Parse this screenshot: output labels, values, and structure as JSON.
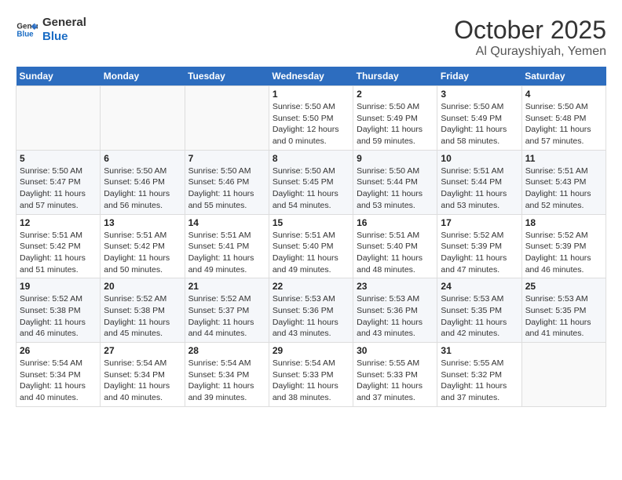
{
  "header": {
    "logo_line1": "General",
    "logo_line2": "Blue",
    "title": "October 2025",
    "location": "Al Qurayshiyah, Yemen"
  },
  "days_of_week": [
    "Sunday",
    "Monday",
    "Tuesday",
    "Wednesday",
    "Thursday",
    "Friday",
    "Saturday"
  ],
  "weeks": [
    [
      {
        "day": "",
        "info": ""
      },
      {
        "day": "",
        "info": ""
      },
      {
        "day": "",
        "info": ""
      },
      {
        "day": "1",
        "info": "Sunrise: 5:50 AM\nSunset: 5:50 PM\nDaylight: 12 hours\nand 0 minutes."
      },
      {
        "day": "2",
        "info": "Sunrise: 5:50 AM\nSunset: 5:49 PM\nDaylight: 11 hours\nand 59 minutes."
      },
      {
        "day": "3",
        "info": "Sunrise: 5:50 AM\nSunset: 5:49 PM\nDaylight: 11 hours\nand 58 minutes."
      },
      {
        "day": "4",
        "info": "Sunrise: 5:50 AM\nSunset: 5:48 PM\nDaylight: 11 hours\nand 57 minutes."
      }
    ],
    [
      {
        "day": "5",
        "info": "Sunrise: 5:50 AM\nSunset: 5:47 PM\nDaylight: 11 hours\nand 57 minutes."
      },
      {
        "day": "6",
        "info": "Sunrise: 5:50 AM\nSunset: 5:46 PM\nDaylight: 11 hours\nand 56 minutes."
      },
      {
        "day": "7",
        "info": "Sunrise: 5:50 AM\nSunset: 5:46 PM\nDaylight: 11 hours\nand 55 minutes."
      },
      {
        "day": "8",
        "info": "Sunrise: 5:50 AM\nSunset: 5:45 PM\nDaylight: 11 hours\nand 54 minutes."
      },
      {
        "day": "9",
        "info": "Sunrise: 5:50 AM\nSunset: 5:44 PM\nDaylight: 11 hours\nand 53 minutes."
      },
      {
        "day": "10",
        "info": "Sunrise: 5:51 AM\nSunset: 5:44 PM\nDaylight: 11 hours\nand 53 minutes."
      },
      {
        "day": "11",
        "info": "Sunrise: 5:51 AM\nSunset: 5:43 PM\nDaylight: 11 hours\nand 52 minutes."
      }
    ],
    [
      {
        "day": "12",
        "info": "Sunrise: 5:51 AM\nSunset: 5:42 PM\nDaylight: 11 hours\nand 51 minutes."
      },
      {
        "day": "13",
        "info": "Sunrise: 5:51 AM\nSunset: 5:42 PM\nDaylight: 11 hours\nand 50 minutes."
      },
      {
        "day": "14",
        "info": "Sunrise: 5:51 AM\nSunset: 5:41 PM\nDaylight: 11 hours\nand 49 minutes."
      },
      {
        "day": "15",
        "info": "Sunrise: 5:51 AM\nSunset: 5:40 PM\nDaylight: 11 hours\nand 49 minutes."
      },
      {
        "day": "16",
        "info": "Sunrise: 5:51 AM\nSunset: 5:40 PM\nDaylight: 11 hours\nand 48 minutes."
      },
      {
        "day": "17",
        "info": "Sunrise: 5:52 AM\nSunset: 5:39 PM\nDaylight: 11 hours\nand 47 minutes."
      },
      {
        "day": "18",
        "info": "Sunrise: 5:52 AM\nSunset: 5:39 PM\nDaylight: 11 hours\nand 46 minutes."
      }
    ],
    [
      {
        "day": "19",
        "info": "Sunrise: 5:52 AM\nSunset: 5:38 PM\nDaylight: 11 hours\nand 46 minutes."
      },
      {
        "day": "20",
        "info": "Sunrise: 5:52 AM\nSunset: 5:38 PM\nDaylight: 11 hours\nand 45 minutes."
      },
      {
        "day": "21",
        "info": "Sunrise: 5:52 AM\nSunset: 5:37 PM\nDaylight: 11 hours\nand 44 minutes."
      },
      {
        "day": "22",
        "info": "Sunrise: 5:53 AM\nSunset: 5:36 PM\nDaylight: 11 hours\nand 43 minutes."
      },
      {
        "day": "23",
        "info": "Sunrise: 5:53 AM\nSunset: 5:36 PM\nDaylight: 11 hours\nand 43 minutes."
      },
      {
        "day": "24",
        "info": "Sunrise: 5:53 AM\nSunset: 5:35 PM\nDaylight: 11 hours\nand 42 minutes."
      },
      {
        "day": "25",
        "info": "Sunrise: 5:53 AM\nSunset: 5:35 PM\nDaylight: 11 hours\nand 41 minutes."
      }
    ],
    [
      {
        "day": "26",
        "info": "Sunrise: 5:54 AM\nSunset: 5:34 PM\nDaylight: 11 hours\nand 40 minutes."
      },
      {
        "day": "27",
        "info": "Sunrise: 5:54 AM\nSunset: 5:34 PM\nDaylight: 11 hours\nand 40 minutes."
      },
      {
        "day": "28",
        "info": "Sunrise: 5:54 AM\nSunset: 5:34 PM\nDaylight: 11 hours\nand 39 minutes."
      },
      {
        "day": "29",
        "info": "Sunrise: 5:54 AM\nSunset: 5:33 PM\nDaylight: 11 hours\nand 38 minutes."
      },
      {
        "day": "30",
        "info": "Sunrise: 5:55 AM\nSunset: 5:33 PM\nDaylight: 11 hours\nand 37 minutes."
      },
      {
        "day": "31",
        "info": "Sunrise: 5:55 AM\nSunset: 5:32 PM\nDaylight: 11 hours\nand 37 minutes."
      },
      {
        "day": "",
        "info": ""
      }
    ]
  ]
}
